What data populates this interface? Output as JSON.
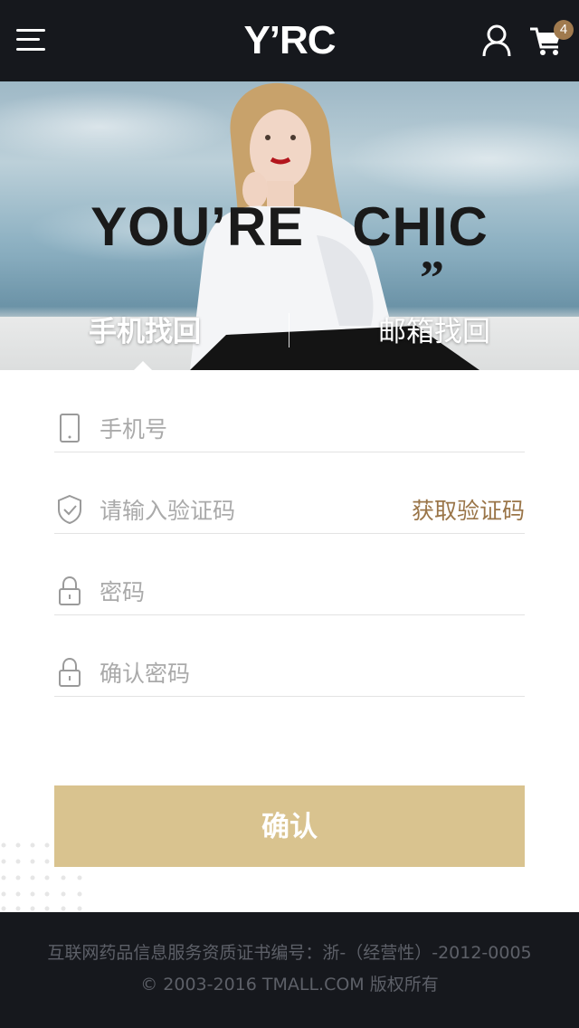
{
  "header": {
    "logo_text": "Y’RC",
    "cart_count": "4",
    "icons": {
      "menu": "menu-icon",
      "user": "user-icon",
      "cart": "cart-icon"
    }
  },
  "hero": {
    "headline": "YOU’RE   CHIC",
    "quote_mark": "”",
    "tabs": [
      {
        "label": "手机找回",
        "active": true
      },
      {
        "label": "邮箱找回",
        "active": false
      }
    ]
  },
  "form": {
    "phone_placeholder": "手机号",
    "code_placeholder": "请输入验证码",
    "get_code_label": "获取验证码",
    "password_placeholder": "密码",
    "confirm_password_placeholder": "确认密码",
    "icons": {
      "phone": "phone-icon",
      "code": "shield-check-icon",
      "password": "lock-icon",
      "confirm_password": "lock-icon"
    }
  },
  "confirm_button_label": "确认",
  "footer": {
    "license": "互联网药品信息服务资质证书编号：浙-（经营性）-2012-0005",
    "copyright": "© 2003-2016 TMALL.COM 版权所有"
  },
  "colors": {
    "top_bar": "#16181d",
    "accent_gold": "#9a7548",
    "button_gold": "#d9c38f",
    "badge": "#a07a4e"
  }
}
